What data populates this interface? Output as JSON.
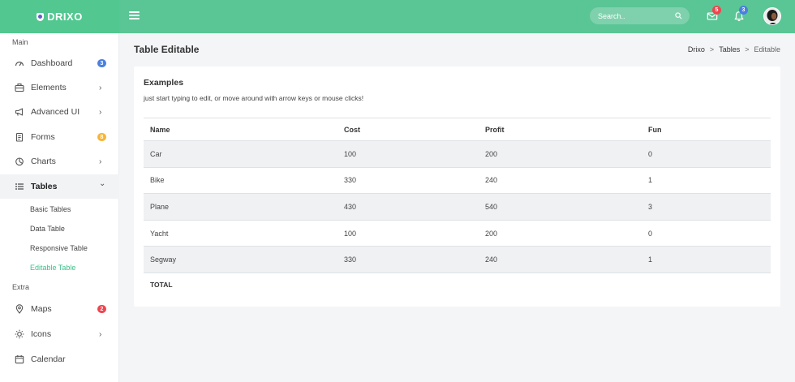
{
  "brand": {
    "name": "DRIXO"
  },
  "topbar": {
    "search_placeholder": "Search..",
    "mail_badge": "5",
    "notif_badge": "3",
    "colors": {
      "bar": "#5ac595",
      "mail_badge": "#f0454f",
      "notif_badge": "#4a7fe0"
    }
  },
  "sidebar": {
    "main_heading": "Main",
    "extra_heading": "Extra",
    "items": [
      {
        "label": "Dashboard",
        "icon": "dashboard-gauge-icon",
        "badge": "3",
        "badge_color": "#4a7fe0"
      },
      {
        "label": "Elements",
        "icon": "briefcase-icon",
        "chevron": "›"
      },
      {
        "label": "Advanced UI",
        "icon": "megaphone-icon",
        "chevron": "›"
      },
      {
        "label": "Forms",
        "icon": "clipboard-icon",
        "badge": "8",
        "badge_color": "#f7b538"
      },
      {
        "label": "Charts",
        "icon": "pie-chart-icon",
        "chevron": "›"
      },
      {
        "label": "Tables",
        "icon": "list-icon",
        "chevron": "⌄"
      }
    ],
    "sub_items": [
      "Basic Tables",
      "Data Table",
      "Responsive Table",
      "Editable Table"
    ],
    "extra_items": [
      {
        "label": "Maps",
        "icon": "map-pin-icon",
        "badge": "2",
        "badge_color": "#f0454f"
      },
      {
        "label": "Icons",
        "icon": "sun-icon",
        "chevron": "›"
      },
      {
        "label": "Calendar",
        "icon": "calendar-icon"
      }
    ]
  },
  "page": {
    "title": "Table Editable",
    "breadcrumb": [
      "Drixo",
      "Tables",
      "Editable"
    ]
  },
  "card": {
    "title": "Examples",
    "subtitle": "just start typing to edit, or move around with arrow keys or mouse clicks!",
    "columns": [
      "Name",
      "Cost",
      "Profit",
      "Fun"
    ],
    "rows": [
      [
        "Car",
        "100",
        "200",
        "0"
      ],
      [
        "Bike",
        "330",
        "240",
        "1"
      ],
      [
        "Plane",
        "430",
        "540",
        "3"
      ],
      [
        "Yacht",
        "100",
        "200",
        "0"
      ],
      [
        "Segway",
        "330",
        "240",
        "1"
      ]
    ],
    "footer_label": "TOTAL"
  }
}
